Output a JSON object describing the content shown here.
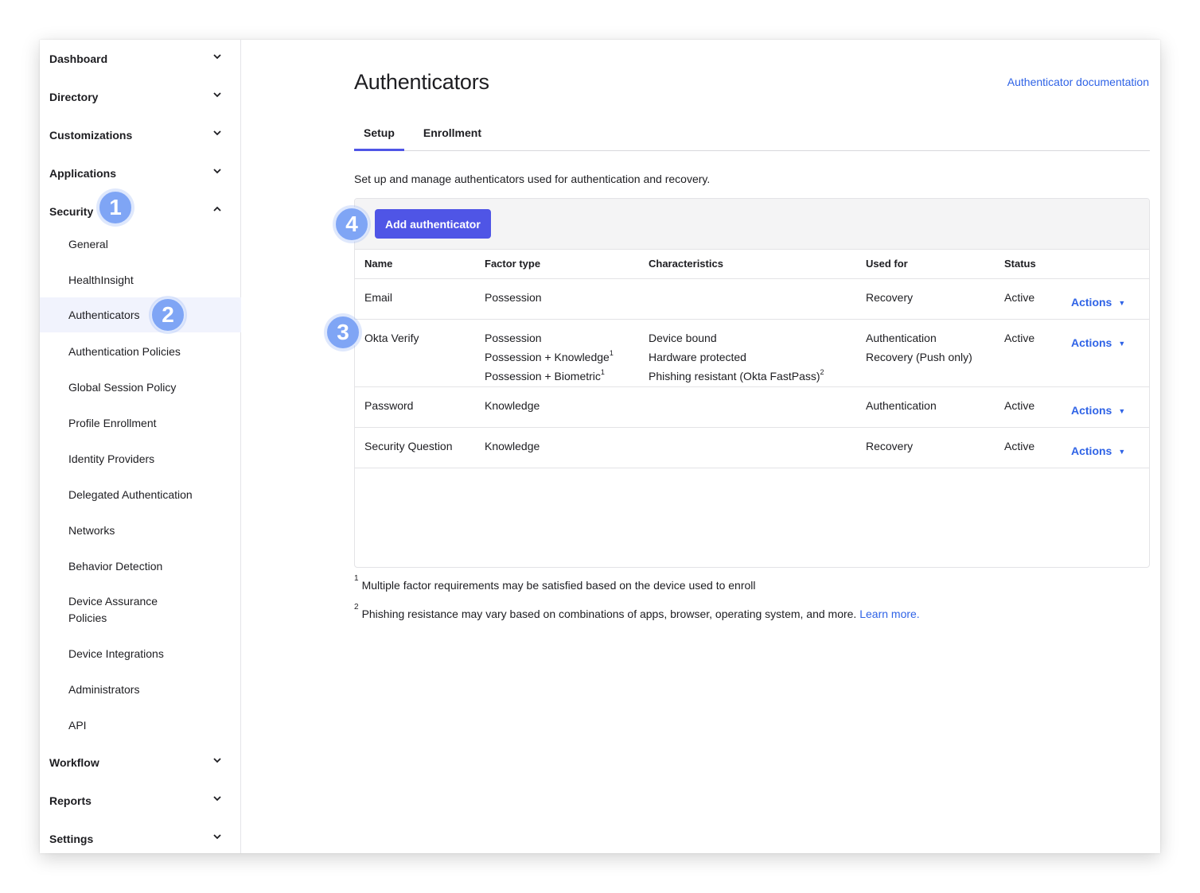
{
  "sidebar": {
    "top": [
      {
        "label": "Dashboard"
      },
      {
        "label": "Directory"
      },
      {
        "label": "Customizations"
      },
      {
        "label": "Applications"
      },
      {
        "label": "Security"
      }
    ],
    "security_items": [
      {
        "label": "General"
      },
      {
        "label": "HealthInsight"
      },
      {
        "label": "Authenticators"
      },
      {
        "label": "Authentication Policies"
      },
      {
        "label": "Global Session Policy"
      },
      {
        "label": "Profile Enrollment"
      },
      {
        "label": "Identity Providers"
      },
      {
        "label": "Delegated Authentication"
      },
      {
        "label": "Networks"
      },
      {
        "label": "Behavior Detection"
      },
      {
        "label": "Device Assurance Policies"
      },
      {
        "label": "Device Integrations"
      },
      {
        "label": "Administrators"
      },
      {
        "label": "API"
      }
    ],
    "bottom": [
      {
        "label": "Workflow"
      },
      {
        "label": "Reports"
      },
      {
        "label": "Settings"
      }
    ]
  },
  "callouts": [
    "1",
    "2",
    "3",
    "4"
  ],
  "header": {
    "title": "Authenticators",
    "doc_link": "Authenticator documentation"
  },
  "tabs": [
    {
      "label": "Setup",
      "active": true
    },
    {
      "label": "Enrollment",
      "active": false
    }
  ],
  "intro": "Set up and manage authenticators used for authentication and recovery.",
  "toolbar": {
    "add_label": "Add authenticator"
  },
  "table": {
    "columns": [
      "Name",
      "Factor type",
      "Characteristics",
      "Used for",
      "Status"
    ],
    "rows": [
      {
        "name": "Email",
        "factor": [
          "Possession"
        ],
        "factor_sup": [
          ""
        ],
        "characteristics": [],
        "char_sup": [],
        "used_for": [
          "Recovery"
        ],
        "status": "Active",
        "action": "Actions"
      },
      {
        "name": "Okta Verify",
        "factor": [
          "Possession",
          "Possession + Knowledge",
          "Possession + Biometric"
        ],
        "factor_sup": [
          "",
          "1",
          "1"
        ],
        "characteristics": [
          "Device bound",
          "Hardware protected",
          "Phishing resistant (Okta FastPass)"
        ],
        "char_sup": [
          "",
          "",
          "2"
        ],
        "used_for": [
          "Authentication",
          "Recovery (Push only)"
        ],
        "status": "Active",
        "action": "Actions"
      },
      {
        "name": "Password",
        "factor": [
          "Knowledge"
        ],
        "factor_sup": [
          ""
        ],
        "characteristics": [],
        "char_sup": [],
        "used_for": [
          "Authentication"
        ],
        "status": "Active",
        "action": "Actions"
      },
      {
        "name": "Security Question",
        "factor": [
          "Knowledge"
        ],
        "factor_sup": [
          ""
        ],
        "characteristics": [],
        "char_sup": [],
        "used_for": [
          "Recovery"
        ],
        "status": "Active",
        "action": "Actions"
      }
    ]
  },
  "footnotes": {
    "n1_mark": "1",
    "n1": "Multiple factor requirements may be satisfied based on the device used to enroll",
    "n2_mark": "2",
    "n2": "Phishing resistance may vary based on combinations of apps, browser, operating system, and more.",
    "n2_link": "Learn more."
  },
  "colors": {
    "accent": "#4f55e6",
    "link": "#2f63e6",
    "callout": "#7fa5f5",
    "active_nav_bg": "#f1f3fd"
  },
  "icons": {
    "collapsed": "chevron-down-icon",
    "expanded": "chevron-up-icon",
    "actions_caret": "caret-down-icon"
  }
}
